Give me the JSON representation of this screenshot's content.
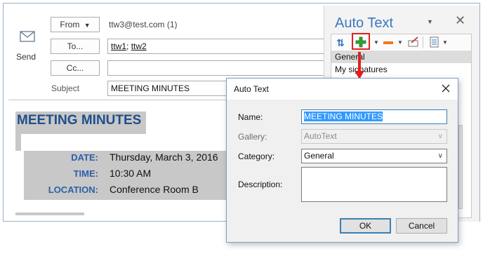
{
  "compose": {
    "send_label": "Send",
    "from_label": "From",
    "from_value": "ttw3@test.com (1)",
    "to_label": "To...",
    "to_recipients": [
      "ttw1",
      "ttw2"
    ],
    "to_separator": ";",
    "cc_label": "Cc...",
    "cc_value": "",
    "subject_label": "Subject",
    "subject_value": "MEETING MINUTES"
  },
  "body": {
    "title": "MEETING MINUTES",
    "rows": [
      {
        "label": "DATE:",
        "value": "Thursday, March 3, 2016"
      },
      {
        "label": "TIME:",
        "value": "10:30 AM"
      },
      {
        "label": "LOCATION:",
        "value": "Conference Room B"
      }
    ]
  },
  "pane": {
    "title": "Auto Text",
    "categories": [
      "General",
      "My signatures"
    ]
  },
  "dialog": {
    "title": "Auto Text",
    "name_label": "Name:",
    "name_value": "MEETING MINUTES",
    "gallery_label": "Gallery:",
    "gallery_value": "AutoText",
    "category_label": "Category:",
    "category_value": "General",
    "description_label": "Description:",
    "description_value": "",
    "ok_label": "OK",
    "cancel_label": "Cancel"
  },
  "colors": {
    "pane_title": "#3a78c2",
    "body_title": "#1f4e8c",
    "body_label": "#2e5fa6",
    "highlight_red": "#e02020",
    "add_green": "#2fa12f",
    "remove_orange": "#f07a1a"
  },
  "icons": [
    "envelope-send-icon",
    "dropdown-arrow-icon",
    "insert-icon",
    "add-icon",
    "remove-icon",
    "rename-icon",
    "pane-menu-icon",
    "close-icon",
    "chevron-down-icon",
    "callout-arrow-icon"
  ]
}
